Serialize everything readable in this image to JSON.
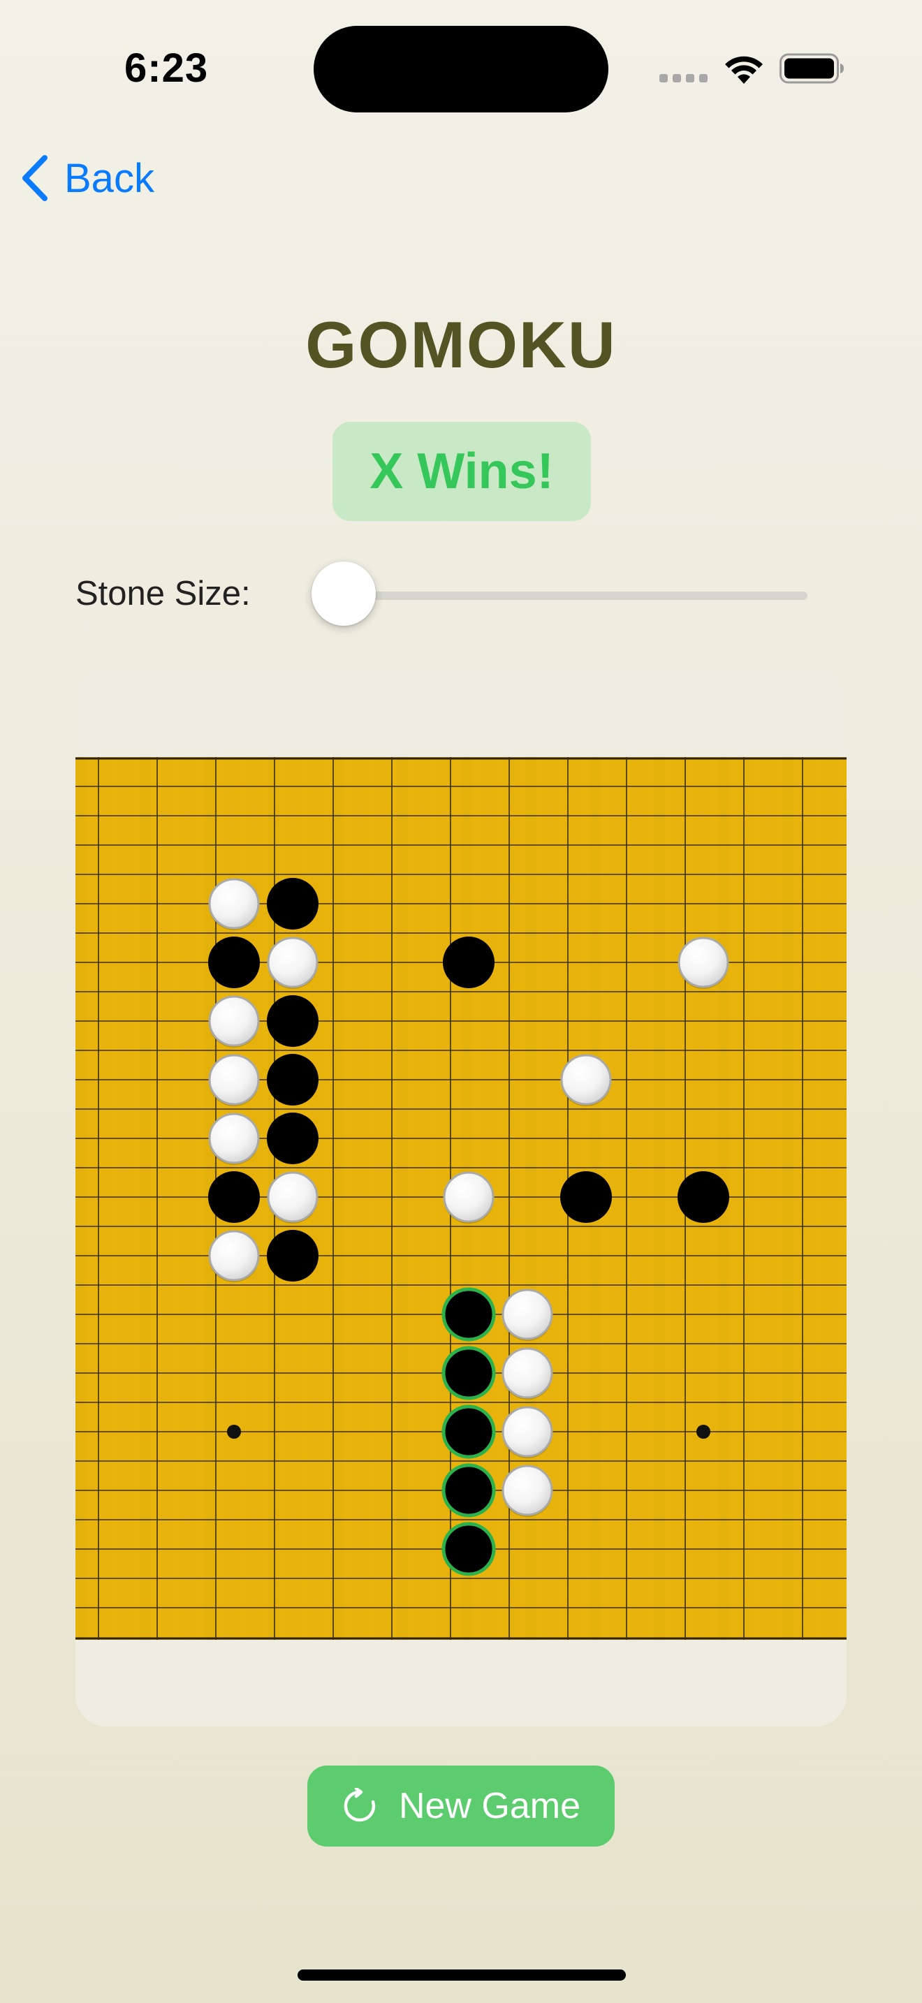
{
  "status_bar": {
    "time": "6:23",
    "icons": [
      "cellular-signal-icon",
      "wifi-icon",
      "battery-icon"
    ]
  },
  "nav": {
    "back_label": "Back",
    "back_icon": "chevron-left-icon"
  },
  "title": "GOMOKU",
  "game_status": "X Wins!",
  "stone_size": {
    "label": "Stone Size:",
    "value_fraction": 0.0
  },
  "board": {
    "size": 15,
    "star_points": [
      [
        2,
        11
      ],
      [
        10,
        11
      ]
    ],
    "stones": [
      {
        "col": 2,
        "row": 2,
        "color": "white"
      },
      {
        "col": 3,
        "row": 2,
        "color": "black"
      },
      {
        "col": 2,
        "row": 3,
        "color": "black"
      },
      {
        "col": 3,
        "row": 3,
        "color": "white"
      },
      {
        "col": 6,
        "row": 3,
        "color": "black"
      },
      {
        "col": 10,
        "row": 3,
        "color": "white"
      },
      {
        "col": 2,
        "row": 4,
        "color": "white"
      },
      {
        "col": 3,
        "row": 4,
        "color": "black"
      },
      {
        "col": 2,
        "row": 5,
        "color": "white"
      },
      {
        "col": 3,
        "row": 5,
        "color": "black"
      },
      {
        "col": 8,
        "row": 5,
        "color": "white"
      },
      {
        "col": 2,
        "row": 6,
        "color": "white"
      },
      {
        "col": 3,
        "row": 6,
        "color": "black"
      },
      {
        "col": 2,
        "row": 7,
        "color": "black"
      },
      {
        "col": 3,
        "row": 7,
        "color": "white"
      },
      {
        "col": 6,
        "row": 7,
        "color": "white"
      },
      {
        "col": 8,
        "row": 7,
        "color": "black"
      },
      {
        "col": 10,
        "row": 7,
        "color": "black"
      },
      {
        "col": 2,
        "row": 8,
        "color": "white"
      },
      {
        "col": 3,
        "row": 8,
        "color": "black"
      },
      {
        "col": 6,
        "row": 9,
        "color": "black",
        "winning": true
      },
      {
        "col": 7,
        "row": 9,
        "color": "white"
      },
      {
        "col": 6,
        "row": 10,
        "color": "black",
        "winning": true
      },
      {
        "col": 7,
        "row": 10,
        "color": "white"
      },
      {
        "col": 6,
        "row": 11,
        "color": "black",
        "winning": true
      },
      {
        "col": 7,
        "row": 11,
        "color": "white"
      },
      {
        "col": 6,
        "row": 12,
        "color": "black",
        "winning": true
      },
      {
        "col": 7,
        "row": 12,
        "color": "white"
      },
      {
        "col": 6,
        "row": 13,
        "color": "black",
        "winning": true
      }
    ]
  },
  "new_game_label": "New Game",
  "new_game_icon": "refresh-icon",
  "colors": {
    "accent_blue": "#0a7aff",
    "title": "#525424",
    "win_green": "#35c759",
    "badge_bg": "#c9e8c5",
    "button_green": "#5ccc6f",
    "board_wood": "#e8b40c",
    "winning_ring": "#2bb24c"
  }
}
